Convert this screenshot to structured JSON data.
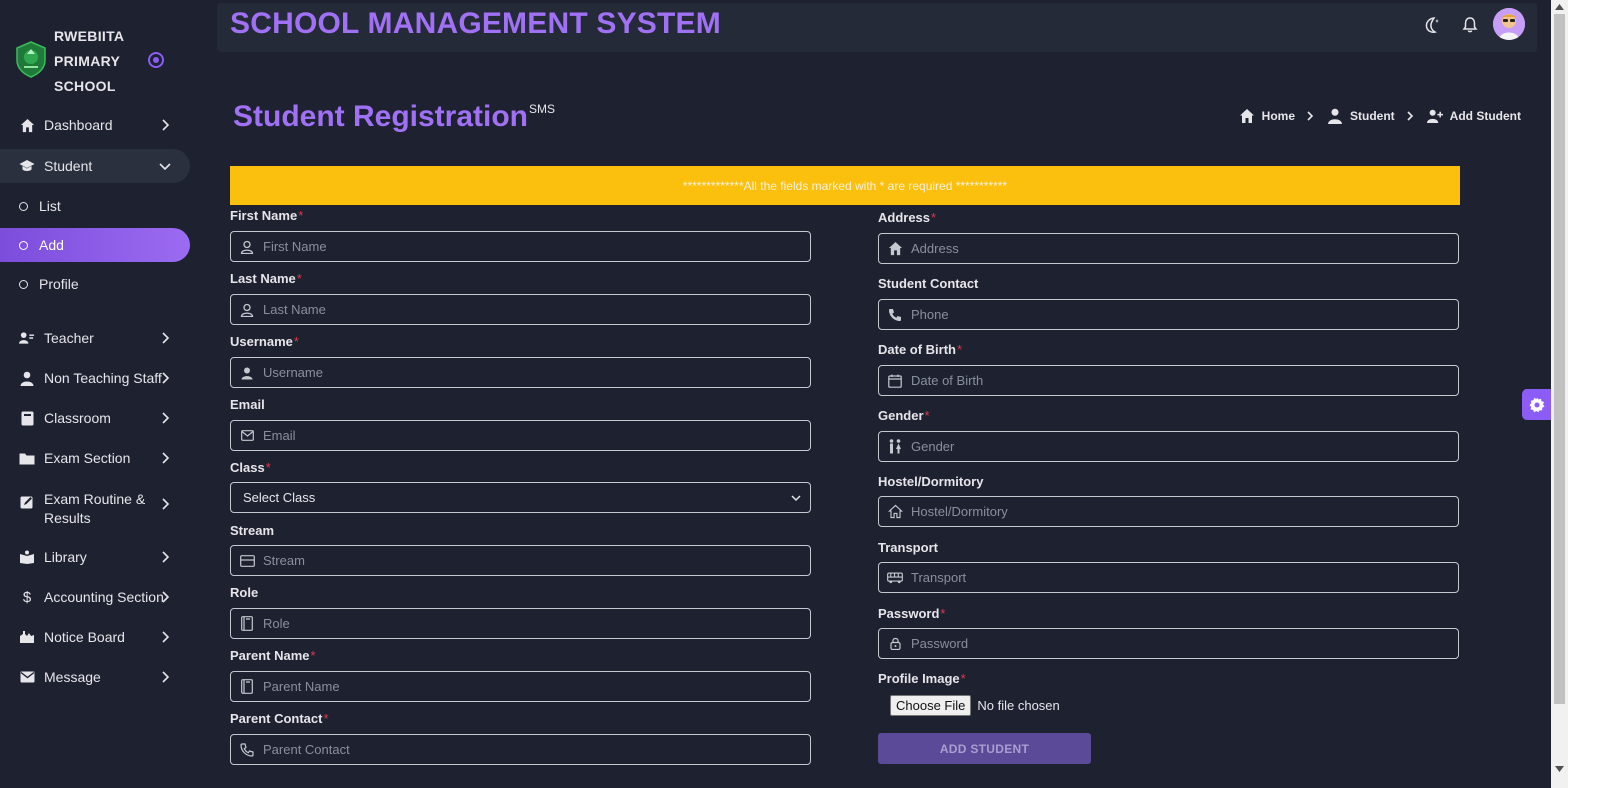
{
  "brand": {
    "line1": "RWEBIITA",
    "line2": "PRIMARY",
    "line3": "SCHOOL"
  },
  "header": {
    "app_title": "SCHOOL MANAGEMENT SYSTEM"
  },
  "sidebar": {
    "dashboard": "Dashboard",
    "student": "Student",
    "sub_list": "List",
    "sub_add": "Add",
    "sub_profile": "Profile",
    "teacher": "Teacher",
    "non_teaching": "Non Teaching Staff",
    "classroom": "Classroom",
    "exam_section": "Exam Section",
    "exam_routine_1": "Exam Routine &",
    "exam_routine_2": "Results",
    "library": "Library",
    "accounting": "Accounting Section",
    "notice_board": "Notice Board",
    "message": "Message"
  },
  "page": {
    "title": "Student Registration",
    "title_sup": "SMS",
    "breadcrumb": {
      "home": "Home",
      "student": "Student",
      "add": "Add Student"
    },
    "notice": "*************All the fields marked with * are required ***********"
  },
  "form": {
    "required_mark": "*",
    "first_name": {
      "label": "First Name",
      "placeholder": "First Name"
    },
    "last_name": {
      "label": "Last Name",
      "placeholder": "Last Name"
    },
    "username": {
      "label": "Username",
      "placeholder": "Username"
    },
    "email": {
      "label": "Email",
      "placeholder": "Email"
    },
    "class": {
      "label": "Class",
      "value": "Select Class"
    },
    "stream": {
      "label": "Stream",
      "placeholder": "Stream"
    },
    "role": {
      "label": "Role",
      "placeholder": "Role"
    },
    "parent_name": {
      "label": "Parent Name",
      "placeholder": "Parent Name"
    },
    "parent_contact": {
      "label": "Parent Contact",
      "placeholder": "Parent Contact"
    },
    "address": {
      "label": "Address",
      "placeholder": "Address"
    },
    "student_contact": {
      "label": "Student Contact",
      "placeholder": "Phone"
    },
    "dob": {
      "label": "Date of Birth",
      "placeholder": "Date of Birth"
    },
    "gender": {
      "label": "Gender",
      "placeholder": "Gender"
    },
    "hostel": {
      "label": "Hostel/Dormitory",
      "placeholder": "Hostel/Dormitory"
    },
    "transport": {
      "label": "Transport",
      "placeholder": "Transport"
    },
    "password": {
      "label": "Password",
      "placeholder": "Password"
    },
    "profile_image": {
      "label": "Profile Image",
      "button": "Choose File",
      "status": "No file chosen"
    },
    "submit": "ADD STUDENT"
  },
  "colors": {
    "accent": "#a070f5",
    "notice": "#fbbf0d",
    "required": "#e0394a",
    "background": "#1e2230"
  }
}
